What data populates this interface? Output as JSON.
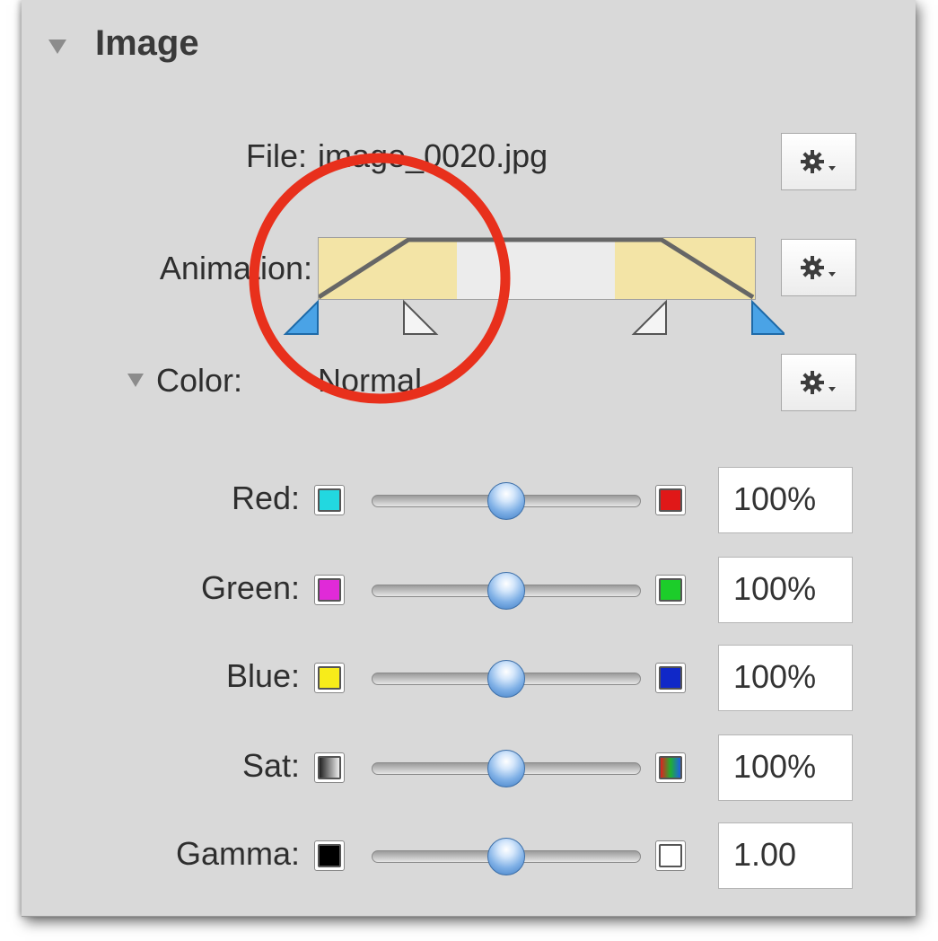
{
  "panel": {
    "title": "Image",
    "file_label": "File:",
    "file_value": "image_0020.jpg",
    "animation_label": "Animation:",
    "color_label": "Color:",
    "color_value": "Normal"
  },
  "icons": {
    "disclosure": "disclosure-triangle-icon",
    "gear": "gear-menu-icon"
  },
  "sliders": [
    {
      "label": "Red:",
      "left_color": "#22d8e0",
      "right_color": "#e01818",
      "value": "100%",
      "position": 0.5
    },
    {
      "label": "Green:",
      "left_color": "#e02ad8",
      "right_color": "#1ccd2a",
      "value": "100%",
      "position": 0.5
    },
    {
      "label": "Blue:",
      "left_color": "#f7ec1a",
      "right_color": "#1028c8",
      "value": "100%",
      "position": 0.5
    },
    {
      "label": "Sat:",
      "left_color": "gradient-gray",
      "right_color": "gradient-rainbow",
      "value": "100%",
      "position": 0.5
    },
    {
      "label": "Gamma:",
      "left_color": "#000000",
      "right_color": "#ffffff",
      "value": "1.00",
      "position": 0.5
    }
  ],
  "colors": {
    "panel_bg": "#d9d9d9",
    "highlight_circle": "#e8301c",
    "animation_fill": "#f3e4a6",
    "knob_blue": "#5b97d8"
  }
}
